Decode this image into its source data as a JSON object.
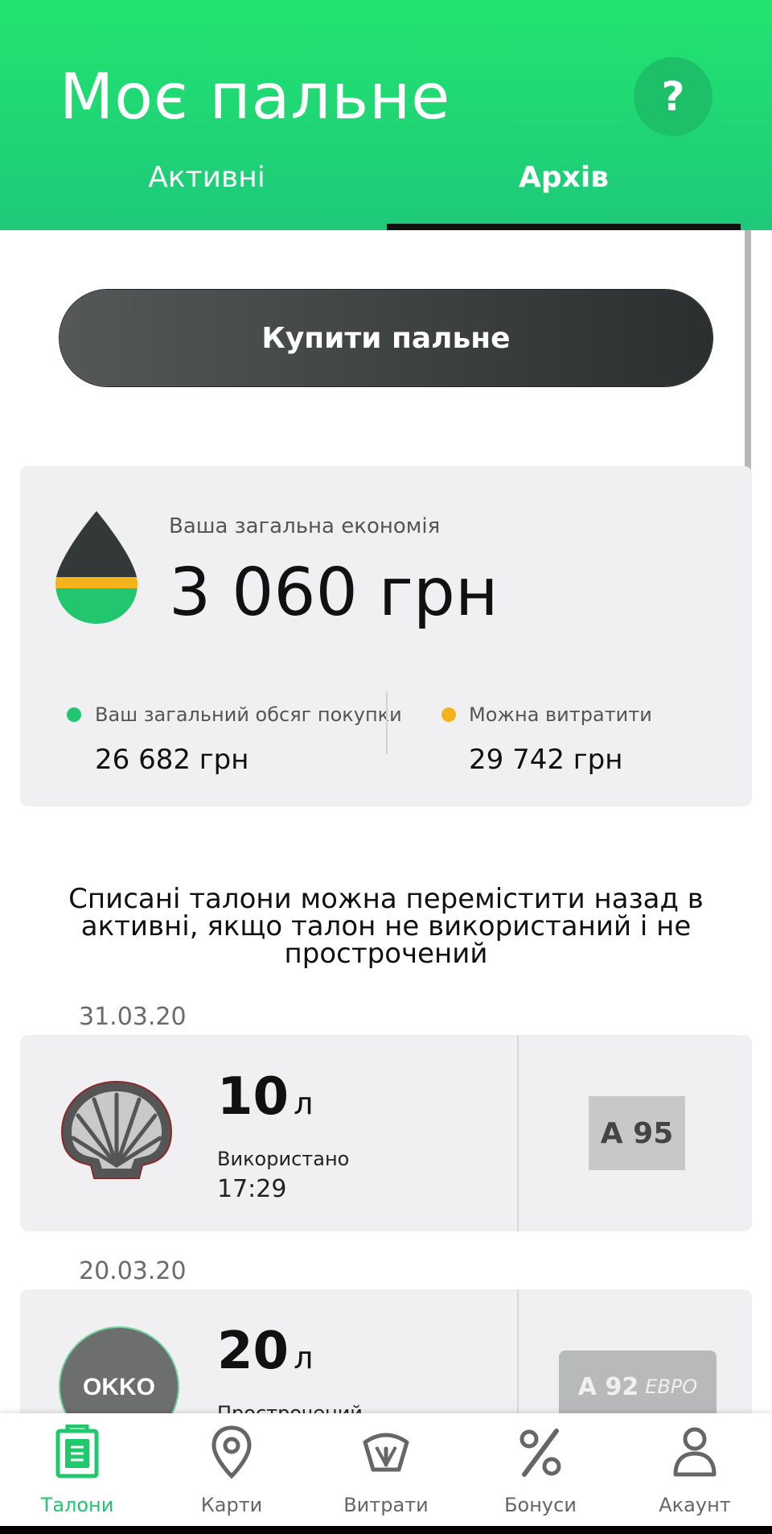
{
  "header": {
    "title": "Моє пальне",
    "help_label": "?",
    "tabs": [
      {
        "label": "Активні",
        "active": false
      },
      {
        "label": "Архів",
        "active": true
      }
    ]
  },
  "buy_button": {
    "label": "Купити пальне"
  },
  "savings": {
    "label": "Ваша загальна економія",
    "value": "3 060 грн",
    "total_label": "Ваш загальний обсяг покупки",
    "total_value": "26 682 грн",
    "spend_label": "Можна витратити",
    "spend_value": "29 742 грн"
  },
  "note": "Списані талони можна перемістити назад в активні, якщо талон не використаний і не прострочений",
  "coupons": [
    {
      "date": "31.03.20",
      "brand": "Shell",
      "amount": "10",
      "unit": "л",
      "status": "Використано",
      "time": "17:29",
      "fuel": "А 95"
    },
    {
      "date": "20.03.20",
      "brand": "OKKO",
      "amount": "20",
      "unit": "л",
      "status": "Прострочений",
      "time": "",
      "fuel": "А 92",
      "fuel_suffix": "ЕВРО"
    }
  ],
  "bottom_nav": [
    {
      "label": "Талони",
      "icon": "coupon-icon",
      "active": true
    },
    {
      "label": "Карти",
      "icon": "map-pin-icon",
      "active": false
    },
    {
      "label": "Витрати",
      "icon": "gauge-icon",
      "active": false
    },
    {
      "label": "Бонуси",
      "icon": "percent-icon",
      "active": false
    },
    {
      "label": "Акаунт",
      "icon": "user-icon",
      "active": false
    }
  ],
  "colors": {
    "brand_green": "#22e46f",
    "dot_green": "#22c66f",
    "dot_orange": "#f5b21a",
    "drop_dark": "#333838"
  }
}
